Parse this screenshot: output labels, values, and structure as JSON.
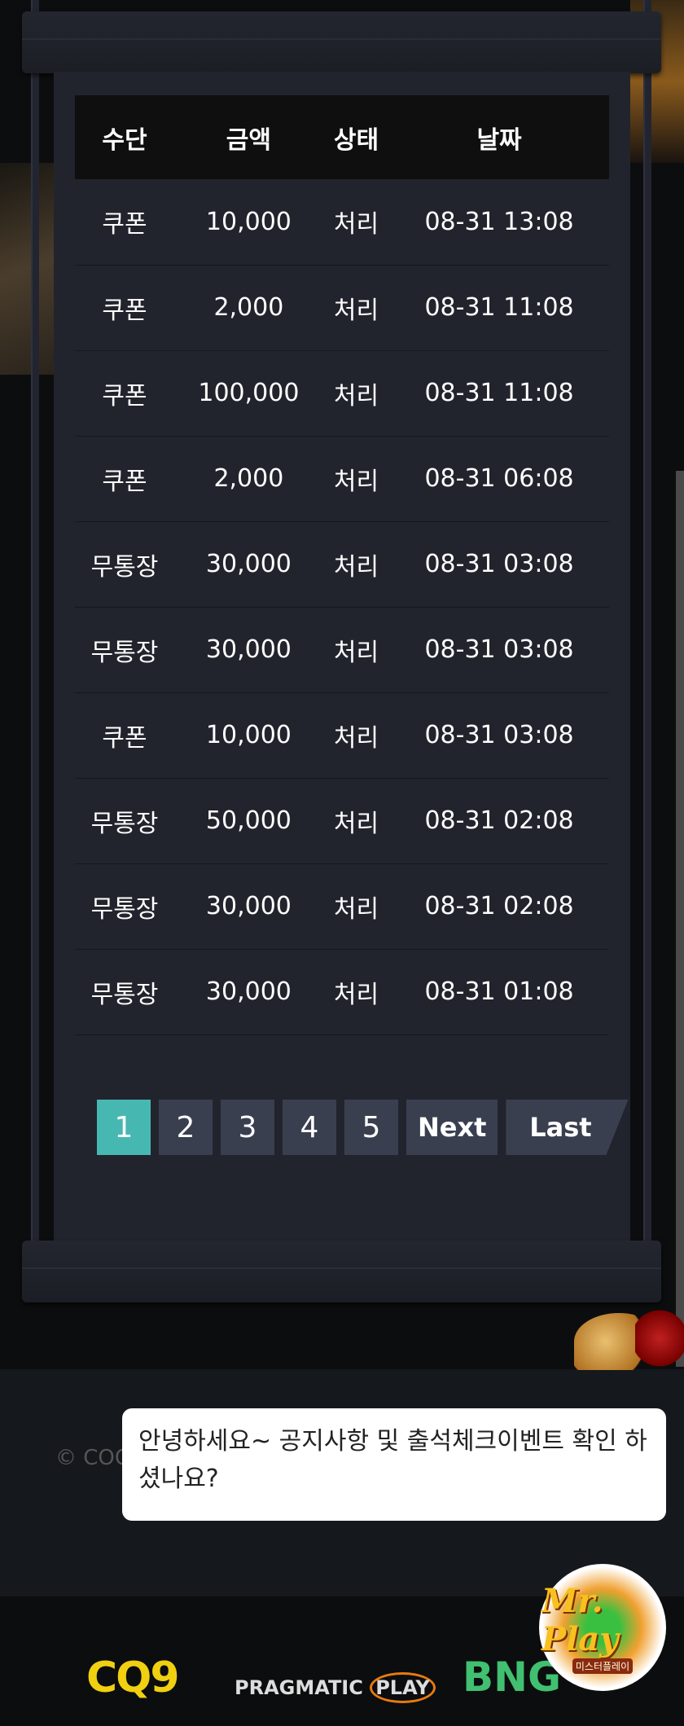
{
  "table": {
    "headers": [
      "수단",
      "금액",
      "상태",
      "날짜"
    ],
    "rows": [
      [
        "쿠폰",
        "10,000",
        "처리",
        "08-31 13:08"
      ],
      [
        "쿠폰",
        "2,000",
        "처리",
        "08-31 11:08"
      ],
      [
        "쿠폰",
        "100,000",
        "처리",
        "08-31 11:08"
      ],
      [
        "쿠폰",
        "2,000",
        "처리",
        "08-31 06:08"
      ],
      [
        "무통장",
        "30,000",
        "처리",
        "08-31 03:08"
      ],
      [
        "무통장",
        "30,000",
        "처리",
        "08-31 03:08"
      ],
      [
        "쿠폰",
        "10,000",
        "처리",
        "08-31 03:08"
      ],
      [
        "무통장",
        "50,000",
        "처리",
        "08-31 02:08"
      ],
      [
        "무통장",
        "30,000",
        "처리",
        "08-31 02:08"
      ],
      [
        "무통장",
        "30,000",
        "처리",
        "08-31 01:08"
      ]
    ]
  },
  "pagination": {
    "pages": [
      "1",
      "2",
      "3",
      "4",
      "5"
    ],
    "current": "1",
    "next": "Next",
    "last": "Last",
    "active_color": "#47b8b1"
  },
  "footer": {
    "copyright": "© COO"
  },
  "chat": {
    "message": "안녕하세요~ 공지사항 및 출석체크이벤트 확인 하셨나요?"
  },
  "chat_widget": {
    "title": "Mr. Play",
    "subtitle": "미스터플레이"
  },
  "providers": [
    "CQ9",
    "PRAGMATIC",
    "PLAY",
    "BNG"
  ]
}
